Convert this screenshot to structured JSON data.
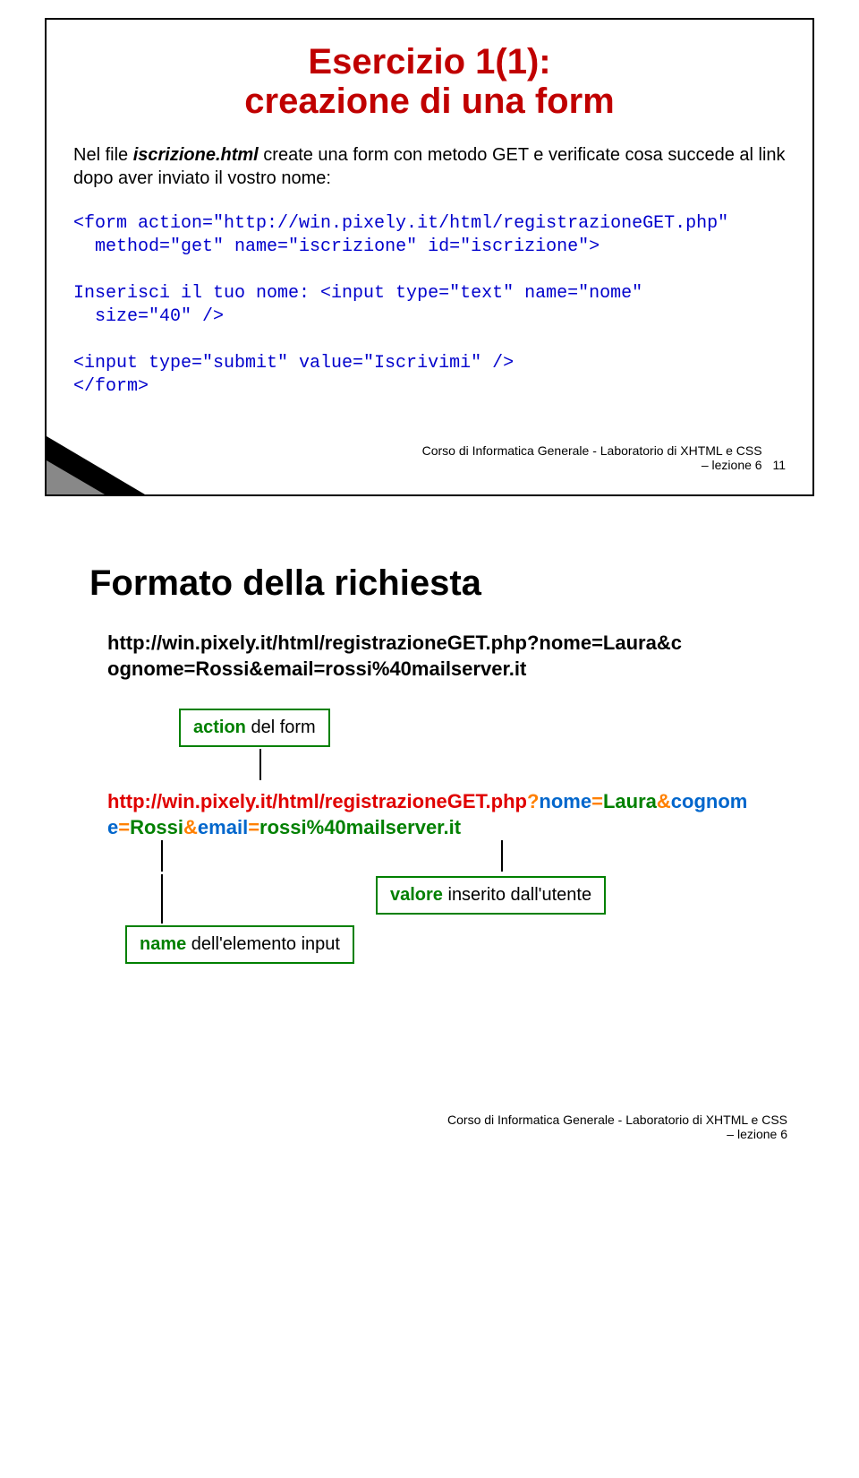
{
  "slide1": {
    "title_line1": "Esercizio 1(1):",
    "title_line2": "creazione di una form",
    "body_prefix": "Nel file ",
    "body_filename": "iscrizione.html",
    "body_suffix": " create una form con metodo GET e verificate cosa succede al link dopo aver inviato il vostro nome:",
    "code": "<form action=\"http://win.pixely.it/html/registrazioneGET.php\"\n  method=\"get\" name=\"iscrizione\" id=\"iscrizione\">\n\nInserisci il tuo nome: <input type=\"text\" name=\"nome\"\n  size=\"40\" />\n\n<input type=\"submit\" value=\"Iscrivimi\" />\n</form>",
    "footer_line1": "Corso di Informatica Generale - Laboratorio di XHTML e CSS",
    "footer_line2": "– lezione 6",
    "page_num": "11"
  },
  "slide2": {
    "title": "Formato della richiesta",
    "url_line1": "http://win.pixely.it/html/registrazioneGET.php?nome=Laura&c",
    "url_line2": "ognome=Rossi&email=rossi%40mailserver.it",
    "action_box_kw": "action",
    "action_box_rest": " del form",
    "colored": {
      "p1_red": "http://win.pixely.it/html/registrazioneGET.php",
      "p1_q": "?",
      "p1_blue1": "nome",
      "p1_eq1": "=",
      "p1_green1": "Laura",
      "p1_amp1": "&",
      "p1_blue2": "cognom",
      "p2_blue2b": "e",
      "p2_eq2": "=",
      "p2_green2": "Rossi",
      "p2_amp2": "&",
      "p2_blue3": "email",
      "p2_eq3": "=",
      "p2_green3": "rossi%40mailserver.it"
    },
    "value_box_kw": "valore",
    "value_box_rest": " inserito dall'utente",
    "name_box_kw": "name",
    "name_box_rest": " dell'elemento input",
    "footer_line1": "Corso di Informatica Generale - Laboratorio di XHTML e CSS",
    "footer_line2": "– lezione 6"
  }
}
